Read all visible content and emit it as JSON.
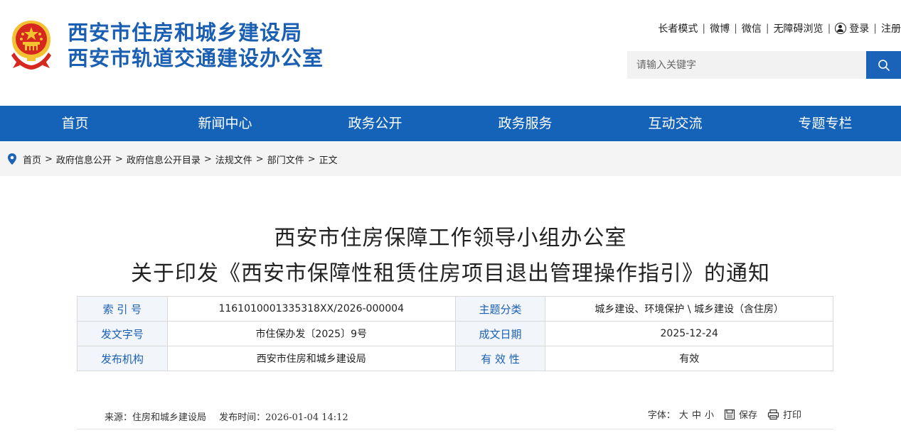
{
  "site": {
    "title_line1": "西安市住房和城乡建设局",
    "title_line2": "西安市轨道交通建设办公室",
    "emblem_icon": "national-emblem-icon"
  },
  "toplinks": {
    "elder_mode": "长者模式",
    "weibo": "微博",
    "wechat": "微信",
    "accessible": "无障碍浏览",
    "login": "登录",
    "register": "注册"
  },
  "search": {
    "placeholder": "请输入关键字",
    "button_icon": "search-icon"
  },
  "nav": {
    "items": [
      "首页",
      "新闻中心",
      "政务公开",
      "政务服务",
      "互动交流",
      "专题专栏"
    ]
  },
  "breadcrumb": {
    "items": [
      "首页",
      "政府信息公开",
      "政府信息公开目录",
      "法规文件",
      "部门文件",
      "正文"
    ]
  },
  "document": {
    "title_line1": "西安市住房保障工作领导小组办公室",
    "title_line2": "关于印发《西安市保障性租赁住房项目退出管理操作指引》的通知",
    "meta": {
      "index_label": "索 引 号",
      "index_value": "1161010001335318XX/2026-000004",
      "topic_label": "主题分类",
      "topic_value": "城乡建设、环境保护 \\ 城乡建设（含住房）",
      "docno_label": "发文字号",
      "docno_value": "市住保办发〔2025〕9号",
      "date_label": "成文日期",
      "date_value": "2025-12-24",
      "issuer_label": "发布机构",
      "issuer_value": "西安市住房和城乡建设局",
      "validity_label": "有 效 性",
      "validity_value": "有效"
    },
    "source": "来源：住房和城乡建设局",
    "publish_time": "发布时间：2026-01-04 14:12",
    "font_label": "字体：",
    "font_large": "大",
    "font_medium": "中",
    "font_small": "小",
    "save": "保存",
    "print": "打印"
  },
  "colors": {
    "brand_blue": "#1463b8",
    "title_blue": "#1b5fb3",
    "emblem_red": "#d7281f",
    "emblem_gold": "#f2c230"
  }
}
